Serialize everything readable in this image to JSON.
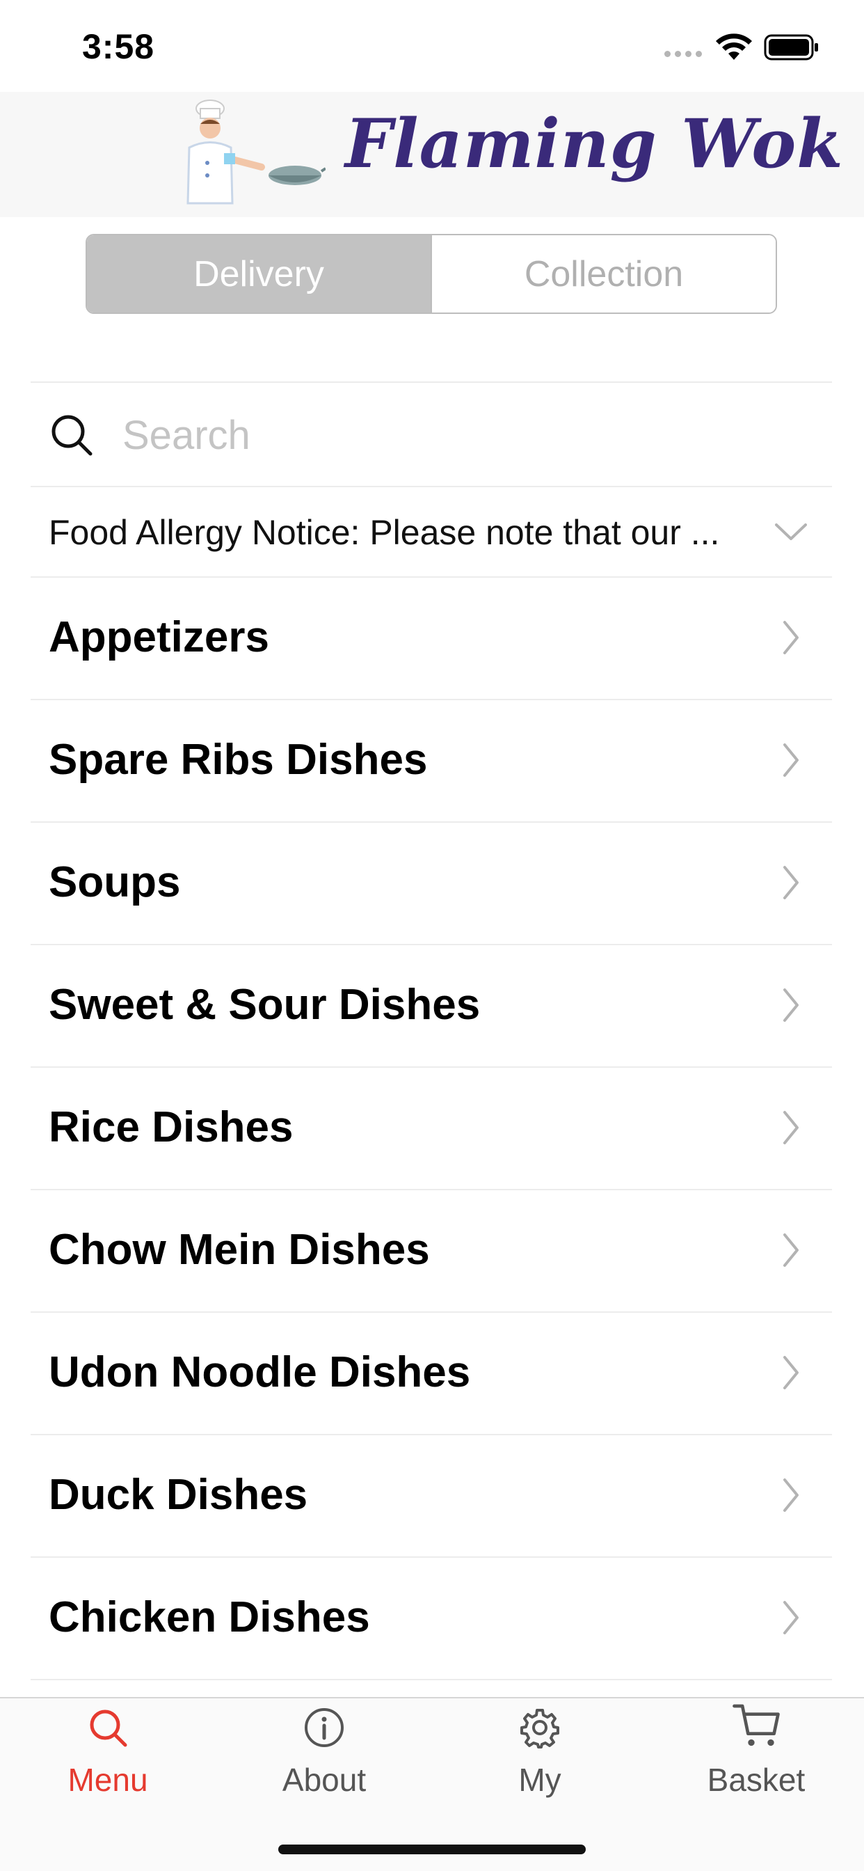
{
  "status_bar": {
    "time": "3:58"
  },
  "header": {
    "logo_text": "Flaming Wok",
    "logo_color": "#3a2a7a"
  },
  "order_mode": {
    "options": [
      {
        "label": "Delivery",
        "selected": true
      },
      {
        "label": "Collection",
        "selected": false
      }
    ]
  },
  "search": {
    "placeholder": "Search",
    "value": ""
  },
  "allergy_notice": {
    "text": "Food Allergy Notice: Please note that our ..."
  },
  "categories": [
    {
      "label": "Appetizers"
    },
    {
      "label": "Spare Ribs Dishes"
    },
    {
      "label": "Soups"
    },
    {
      "label": "Sweet & Sour Dishes"
    },
    {
      "label": "Rice Dishes"
    },
    {
      "label": "Chow Mein Dishes"
    },
    {
      "label": "Udon Noodle Dishes"
    },
    {
      "label": "Duck Dishes"
    },
    {
      "label": "Chicken Dishes"
    }
  ],
  "tab_bar": {
    "accent_color": "#e53a2f",
    "tabs": [
      {
        "label": "Menu",
        "icon": "search-icon",
        "active": true
      },
      {
        "label": "About",
        "icon": "info-icon",
        "active": false
      },
      {
        "label": "My",
        "icon": "gear-icon",
        "active": false
      },
      {
        "label": "Basket",
        "icon": "cart-icon",
        "active": false
      }
    ]
  }
}
